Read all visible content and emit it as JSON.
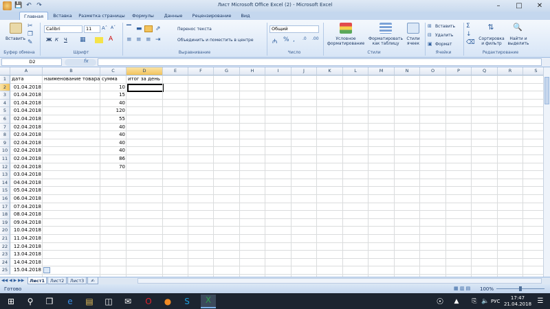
{
  "window": {
    "title": "Лист Microsoft Office Excel (2) - Microsoft Excel"
  },
  "ribbon": {
    "tabs": [
      "Главная",
      "Вставка",
      "Разметка страницы",
      "Формулы",
      "Данные",
      "Рецензирование",
      "Вид"
    ],
    "active_tab": "Главная",
    "clipboard": {
      "paste": "Вставить",
      "group": "Буфер обмена"
    },
    "font": {
      "name": "Calibri",
      "size": "11",
      "group": "Шрифт",
      "bold": "Ж",
      "italic": "К",
      "underline": "Ч"
    },
    "alignment": {
      "wrap": "Перенос текста",
      "merge": "Объединить и поместить в центре",
      "group": "Выравнивание"
    },
    "number": {
      "format": "Общий",
      "group": "Число"
    },
    "styles": {
      "conditional": "Условное\nформатирование",
      "as_table": "Форматировать\nкак таблицу",
      "cell_styles": "Стили\nячеек",
      "group": "Стили"
    },
    "cells": {
      "insert": "Вставить",
      "delete": "Удалить",
      "format": "Формат",
      "group": "Ячейки"
    },
    "editing": {
      "sort": "Сортировка\nи фильтр",
      "find": "Найти и\nвыделить",
      "group": "Редактирование"
    }
  },
  "formula_bar": {
    "name_box": "D2",
    "fx": "fx",
    "content": ""
  },
  "grid": {
    "columns": [
      "A",
      "B",
      "C",
      "D",
      "E",
      "F",
      "G",
      "H",
      "I",
      "J",
      "K",
      "L",
      "M",
      "N",
      "O",
      "P",
      "Q",
      "R",
      "S"
    ],
    "selected_column": "D",
    "selected_row": 2,
    "headers": {
      "A": "дата",
      "B": "наименование товара",
      "C": "сумма",
      "D": "итог за день"
    },
    "rows": [
      {
        "n": 1
      },
      {
        "n": 2,
        "date": "01.04.2018",
        "sum": "10"
      },
      {
        "n": 3,
        "date": "01.04.2018",
        "sum": "15"
      },
      {
        "n": 4,
        "date": "01.04.2018",
        "sum": "40"
      },
      {
        "n": 5,
        "date": "01.04.2018",
        "sum": "120"
      },
      {
        "n": 6,
        "date": "02.04.2018",
        "sum": "55"
      },
      {
        "n": 7,
        "date": "02.04.2018",
        "sum": "40"
      },
      {
        "n": 8,
        "date": "02.04.2018",
        "sum": "40"
      },
      {
        "n": 9,
        "date": "02.04.2018",
        "sum": "40"
      },
      {
        "n": 10,
        "date": "02.04.2018",
        "sum": "40"
      },
      {
        "n": 11,
        "date": "02.04.2018",
        "sum": "86"
      },
      {
        "n": 12,
        "date": "02.04.2018",
        "sum": "70"
      },
      {
        "n": 13,
        "date": "03.04.2018"
      },
      {
        "n": 14,
        "date": "04.04.2018"
      },
      {
        "n": 15,
        "date": "05.04.2018"
      },
      {
        "n": 16,
        "date": "06.04.2018"
      },
      {
        "n": 17,
        "date": "07.04.2018"
      },
      {
        "n": 18,
        "date": "08.04.2018"
      },
      {
        "n": 19,
        "date": "09.04.2018"
      },
      {
        "n": 20,
        "date": "10.04.2018"
      },
      {
        "n": 21,
        "date": "11.04.2018"
      },
      {
        "n": 22,
        "date": "12.04.2018"
      },
      {
        "n": 23,
        "date": "13.04.2018"
      },
      {
        "n": 24,
        "date": "14.04.2018"
      },
      {
        "n": 25,
        "date": "15.04.2018"
      }
    ]
  },
  "sheets": {
    "tabs": [
      "Лист1",
      "Лист2",
      "Лист3"
    ],
    "active": "Лист1"
  },
  "status": {
    "ready": "Готово",
    "zoom": "100%"
  },
  "taskbar": {
    "lang": "РУС",
    "time": "17:47",
    "date": "21.04.2018"
  },
  "colors": {
    "accent": "#f2c35c",
    "ribbon": "#dbe7f6",
    "taskbar": "#1c2430"
  }
}
